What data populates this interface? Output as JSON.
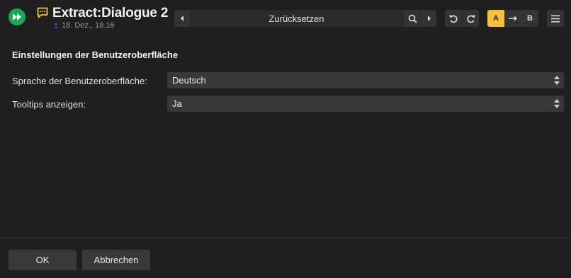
{
  "header": {
    "title": "Extract:Dialogue 2",
    "subtitle": "18. Dez., 18.16",
    "preset_label": "Zurücksetzen",
    "ab": {
      "a_label": "A",
      "b_label": "B"
    },
    "accent_color": "#f4c23a",
    "play_color": "#1aa854"
  },
  "icons": {
    "play": "fast-forward-icon",
    "plugin": "speech-bubble-icon",
    "preset_prev": "triangle-left-icon",
    "preset_search": "search-icon",
    "preset_next": "triangle-right-icon",
    "undo": "undo-icon",
    "redo": "redo-icon",
    "ab_copy": "arrow-right-icon",
    "menu": "hamburger-menu-icon"
  },
  "settings": {
    "section_title": "Einstellungen der Benutzeroberfläche",
    "rows": [
      {
        "label": "Sprache der Benutzeroberfläche:",
        "value": "Deutsch"
      },
      {
        "label": "Tooltips anzeigen:",
        "value": "Ja"
      }
    ]
  },
  "footer": {
    "ok_label": "OK",
    "cancel_label": "Abbrechen"
  }
}
